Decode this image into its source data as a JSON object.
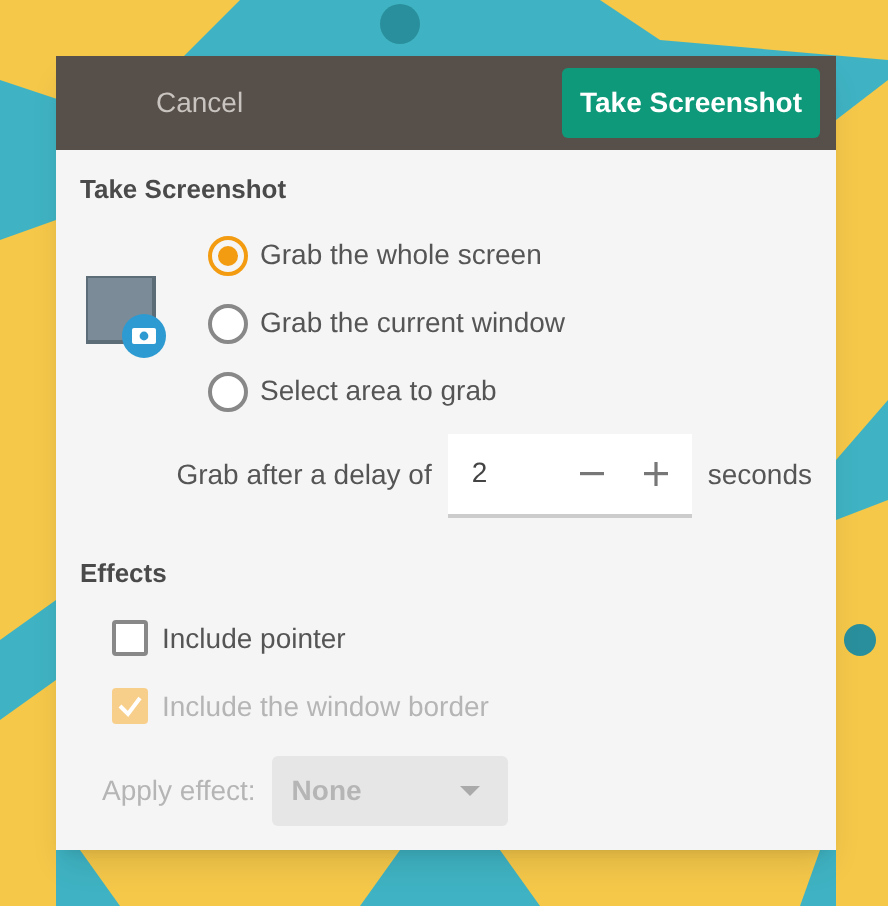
{
  "header": {
    "cancel": "Cancel",
    "confirm": "Take Screenshot"
  },
  "capture": {
    "heading": "Take Screenshot",
    "options": [
      {
        "label": "Grab the whole screen",
        "selected": true
      },
      {
        "label": "Grab the current window",
        "selected": false
      },
      {
        "label": "Select area to grab",
        "selected": false
      }
    ],
    "delay": {
      "prefix": "Grab after a delay of",
      "value": "2",
      "suffix": "seconds"
    }
  },
  "effects": {
    "heading": "Effects",
    "options": [
      {
        "label": "Include pointer",
        "checked": false,
        "disabled": false
      },
      {
        "label": "Include the window border",
        "checked": true,
        "disabled": true
      }
    ],
    "apply": {
      "label": "Apply effect:",
      "value": "None",
      "disabled": true
    }
  }
}
